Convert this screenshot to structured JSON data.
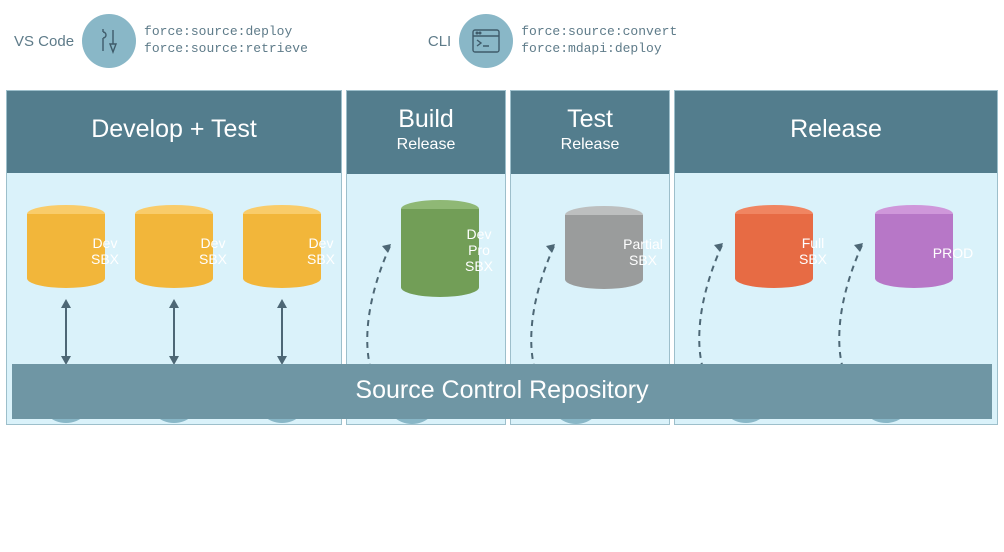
{
  "legend": {
    "vscode": {
      "label": "VS Code",
      "cmd1": "force:source:deploy",
      "cmd2": "force:source:retrieve"
    },
    "cli": {
      "label": "CLI",
      "cmd1": "force:source:convert",
      "cmd2": "force:mdapi:deploy"
    }
  },
  "phases": {
    "develop": {
      "title": "Develop + Test"
    },
    "build": {
      "title": "Build",
      "sub": "Release"
    },
    "test": {
      "title": "Test",
      "sub": "Release"
    },
    "release": {
      "title": "Release"
    }
  },
  "dbs": {
    "devsbx": "Dev\nSBX",
    "devprosbx": "Dev\nPro\nSBX",
    "partialsbx": "Partial\nSBX",
    "fullsbx": "Full\nSBX",
    "prod": "PROD"
  },
  "repo": "Source Control Repository"
}
